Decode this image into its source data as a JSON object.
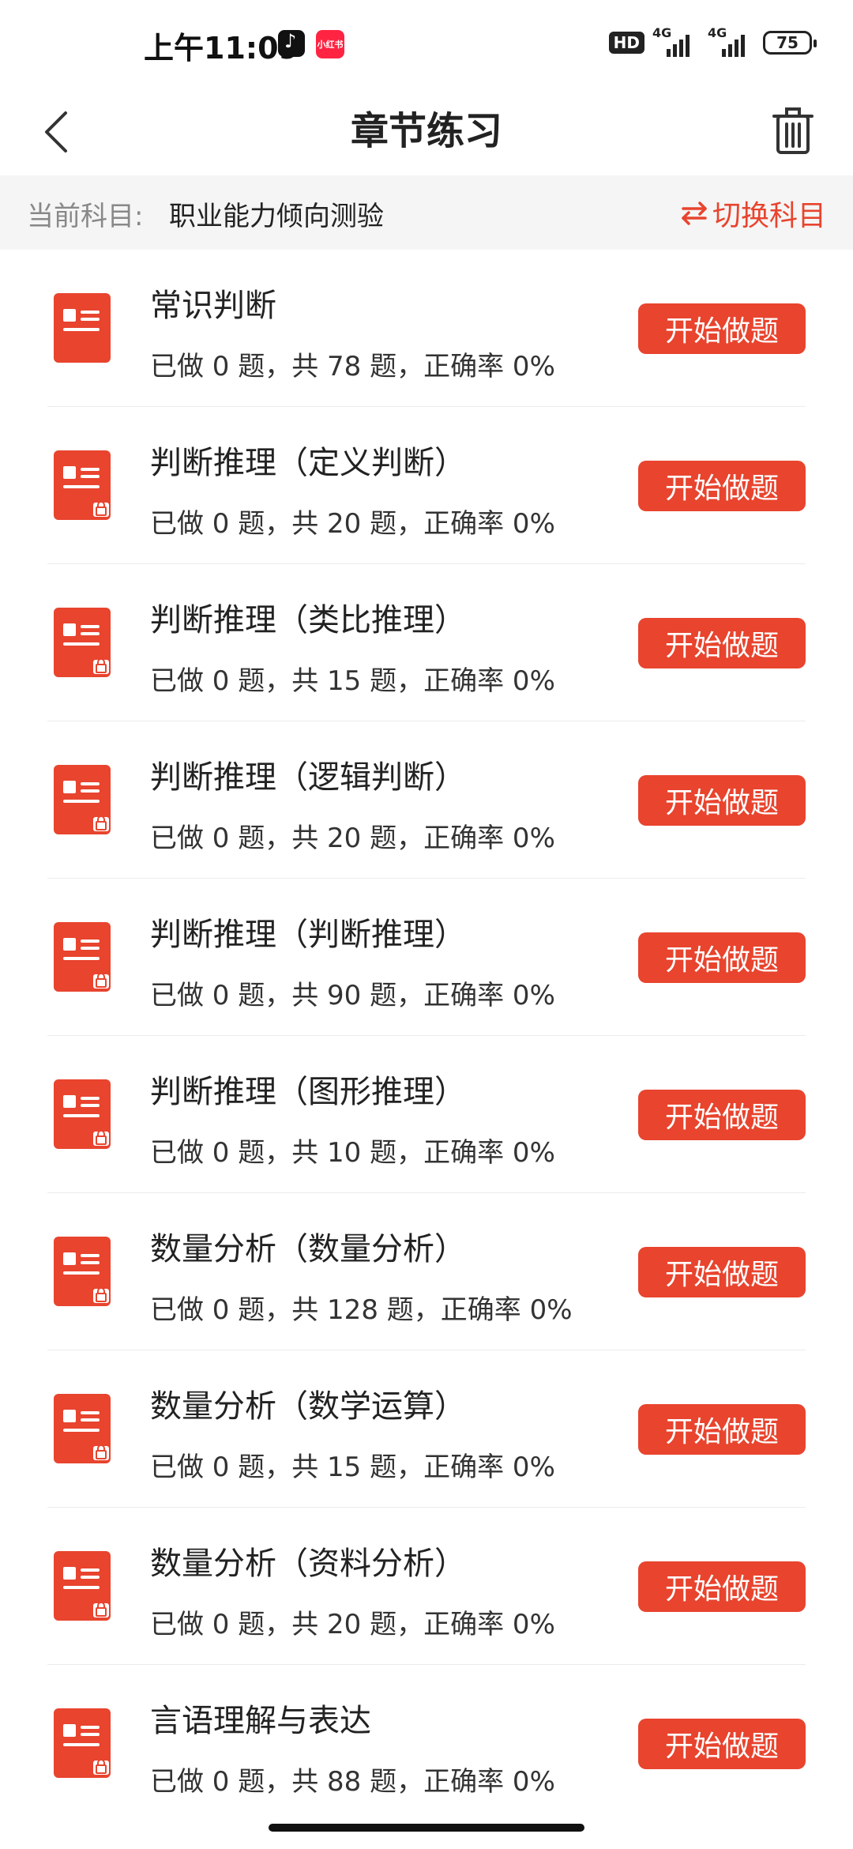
{
  "status_bar": {
    "time": "上午11:09",
    "xhs_app_label": "小红书",
    "hd_label": "HD",
    "net1": "4G",
    "net2": "4G",
    "battery": "75"
  },
  "header": {
    "title": "章节练习",
    "back_icon": "chevron-left-icon",
    "trash_icon": "trash-icon"
  },
  "subject": {
    "label": "当前科目:",
    "value": "职业能力倾向测验",
    "switch_label": "切换科目",
    "switch_icon": "swap-arrows-icon"
  },
  "colors": {
    "accent": "#e8442e",
    "subject_bar_bg": "#f5f5f5"
  },
  "chapters": [
    {
      "title": "常识判断",
      "stats": "已做 0 题，共 78 题，正确率 0%",
      "locked": false,
      "button": "开始做题"
    },
    {
      "title": "判断推理（定义判断）",
      "stats": "已做 0 题，共 20 题，正确率 0%",
      "locked": true,
      "button": "开始做题"
    },
    {
      "title": "判断推理（类比推理）",
      "stats": "已做 0 题，共 15 题，正确率 0%",
      "locked": true,
      "button": "开始做题"
    },
    {
      "title": "判断推理（逻辑判断）",
      "stats": "已做 0 题，共 20 题，正确率 0%",
      "locked": true,
      "button": "开始做题"
    },
    {
      "title": "判断推理（判断推理）",
      "stats": "已做 0 题，共 90 题，正确率 0%",
      "locked": true,
      "button": "开始做题"
    },
    {
      "title": "判断推理（图形推理）",
      "stats": "已做 0 题，共 10 题，正确率 0%",
      "locked": true,
      "button": "开始做题"
    },
    {
      "title": "数量分析（数量分析）",
      "stats": "已做 0 题，共 128 题，正确率 0%",
      "locked": true,
      "button": "开始做题"
    },
    {
      "title": "数量分析（数学运算）",
      "stats": "已做 0 题，共 15 题，正确率 0%",
      "locked": true,
      "button": "开始做题"
    },
    {
      "title": "数量分析（资料分析）",
      "stats": "已做 0 题，共 20 题，正确率 0%",
      "locked": true,
      "button": "开始做题"
    },
    {
      "title": "言语理解与表达",
      "stats": "已做 0 题，共 88 题，正确率 0%",
      "locked": true,
      "button": "开始做题"
    }
  ]
}
